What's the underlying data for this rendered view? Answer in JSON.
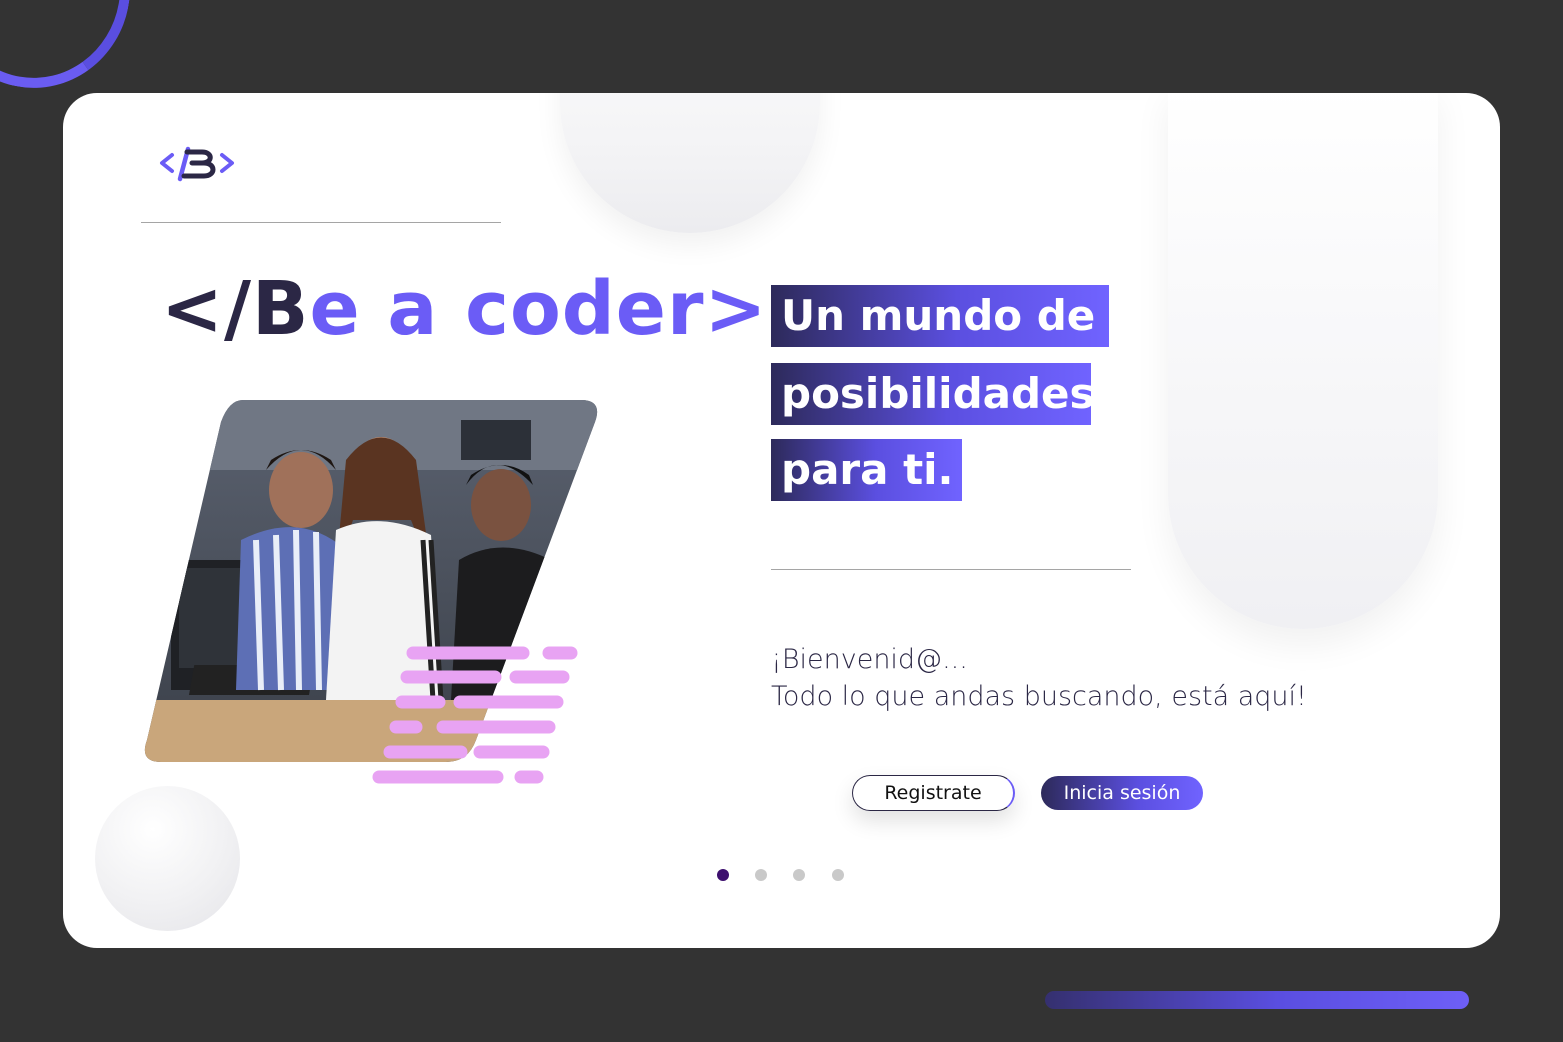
{
  "brand": {
    "logo_text": "</B>",
    "accent_color": "#6b5cf6",
    "dark_color": "#2b2745"
  },
  "hero": {
    "title_dark": "</B",
    "title_accent": "e a coder>"
  },
  "headline": {
    "line1": "Un mundo de",
    "line2": "posibilidades",
    "line3": "para ti."
  },
  "welcome": {
    "line1": "¡Bienvenid@...",
    "line2": "Todo lo que andas buscando, está aquí!"
  },
  "actions": {
    "register_label": "Registrate",
    "login_label": "Inicia sesión"
  },
  "carousel": {
    "total": 4,
    "active_index": 0
  },
  "photo": {
    "icon": "people-at-computer-photo"
  }
}
